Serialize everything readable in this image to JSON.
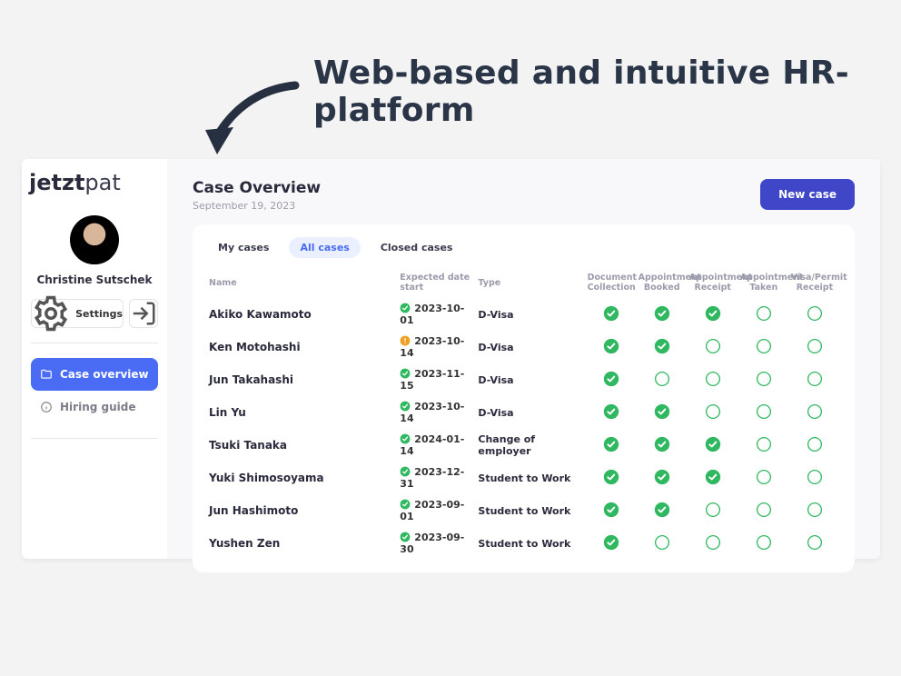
{
  "headline": "Web-based and intuitive HR-platform",
  "brand": {
    "left": "jetzt",
    "right": "pat"
  },
  "sidebar": {
    "user_name": "Christine Sutschek",
    "settings_label": "Settings",
    "nav": {
      "case_overview": "Case overview",
      "hiring_guide": "Hiring guide"
    }
  },
  "page": {
    "title": "Case Overview",
    "date": "September 19, 2023",
    "new_case_label": "New case"
  },
  "tabs": {
    "my": "My cases",
    "all": "All cases",
    "closed": "Closed cases"
  },
  "columns": {
    "name": "Name",
    "expected": "Expected date start",
    "type": "Type",
    "doc": "Document Collection",
    "booked": "Appointment Booked",
    "receipt": "Appointment Receipt",
    "taken": "Appointment Taken",
    "visa": "Visa/Permit Receipt"
  },
  "rows": [
    {
      "name": "Akiko Kawamoto",
      "date": "2023-10-01",
      "date_state": "ok",
      "type": "D-Visa",
      "status": [
        "done",
        "done",
        "done",
        "open",
        "open"
      ]
    },
    {
      "name": "Ken Motohashi",
      "date": "2023-10-14",
      "date_state": "warn",
      "type": "D-Visa",
      "status": [
        "done",
        "done",
        "open",
        "open",
        "open"
      ]
    },
    {
      "name": "Jun Takahashi",
      "date": "2023-11-15",
      "date_state": "ok",
      "type": "D-Visa",
      "status": [
        "done",
        "open",
        "open",
        "open",
        "open"
      ]
    },
    {
      "name": "Lin Yu",
      "date": "2023-10-14",
      "date_state": "ok",
      "type": "D-Visa",
      "status": [
        "done",
        "done",
        "open",
        "open",
        "open"
      ]
    },
    {
      "name": "Tsuki Tanaka",
      "date": "2024-01-14",
      "date_state": "ok",
      "type": "Change of employer",
      "status": [
        "done",
        "done",
        "done",
        "open",
        "open"
      ]
    },
    {
      "name": "Yuki Shimosoyama",
      "date": "2023-12-31",
      "date_state": "ok",
      "type": "Student to Work",
      "status": [
        "done",
        "done",
        "done",
        "open",
        "open"
      ]
    },
    {
      "name": "Jun Hashimoto",
      "date": "2023-09-01",
      "date_state": "ok",
      "type": "Student to Work",
      "status": [
        "done",
        "done",
        "open",
        "open",
        "open"
      ]
    },
    {
      "name": "Yushen Zen",
      "date": "2023-09-30",
      "date_state": "ok",
      "type": "Student to Work",
      "status": [
        "done",
        "open",
        "open",
        "open",
        "open"
      ]
    }
  ]
}
